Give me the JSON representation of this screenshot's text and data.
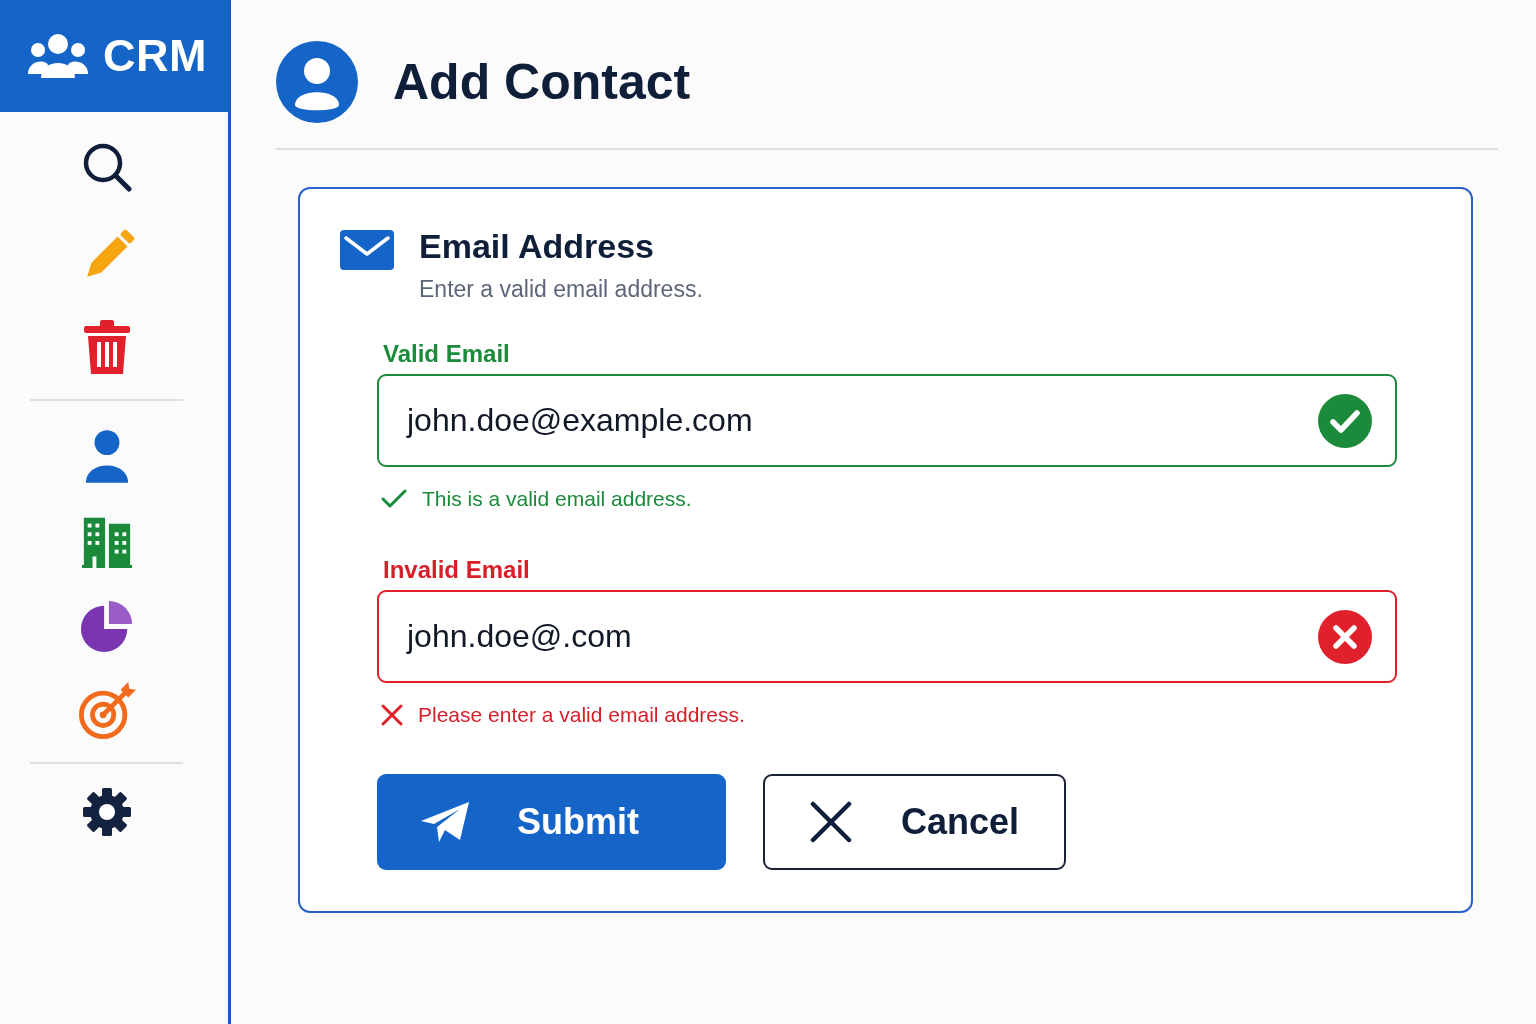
{
  "sidebar": {
    "brand": "CRM"
  },
  "header": {
    "title": "Add Contact"
  },
  "card": {
    "title": "Email Address",
    "description": "Enter a valid email address.",
    "fields": [
      {
        "label": "Valid Email",
        "value": "john.doe@example.com",
        "valid": true,
        "message": "This is a valid email address."
      },
      {
        "label": "Invalid Email",
        "value": "john.doe@.com",
        "valid": false,
        "message": "Please enter a valid email address."
      }
    ],
    "buttons": [
      {
        "label": "Submit",
        "kind": "submit"
      },
      {
        "label": "Cancel",
        "kind": "cancel"
      }
    ]
  }
}
